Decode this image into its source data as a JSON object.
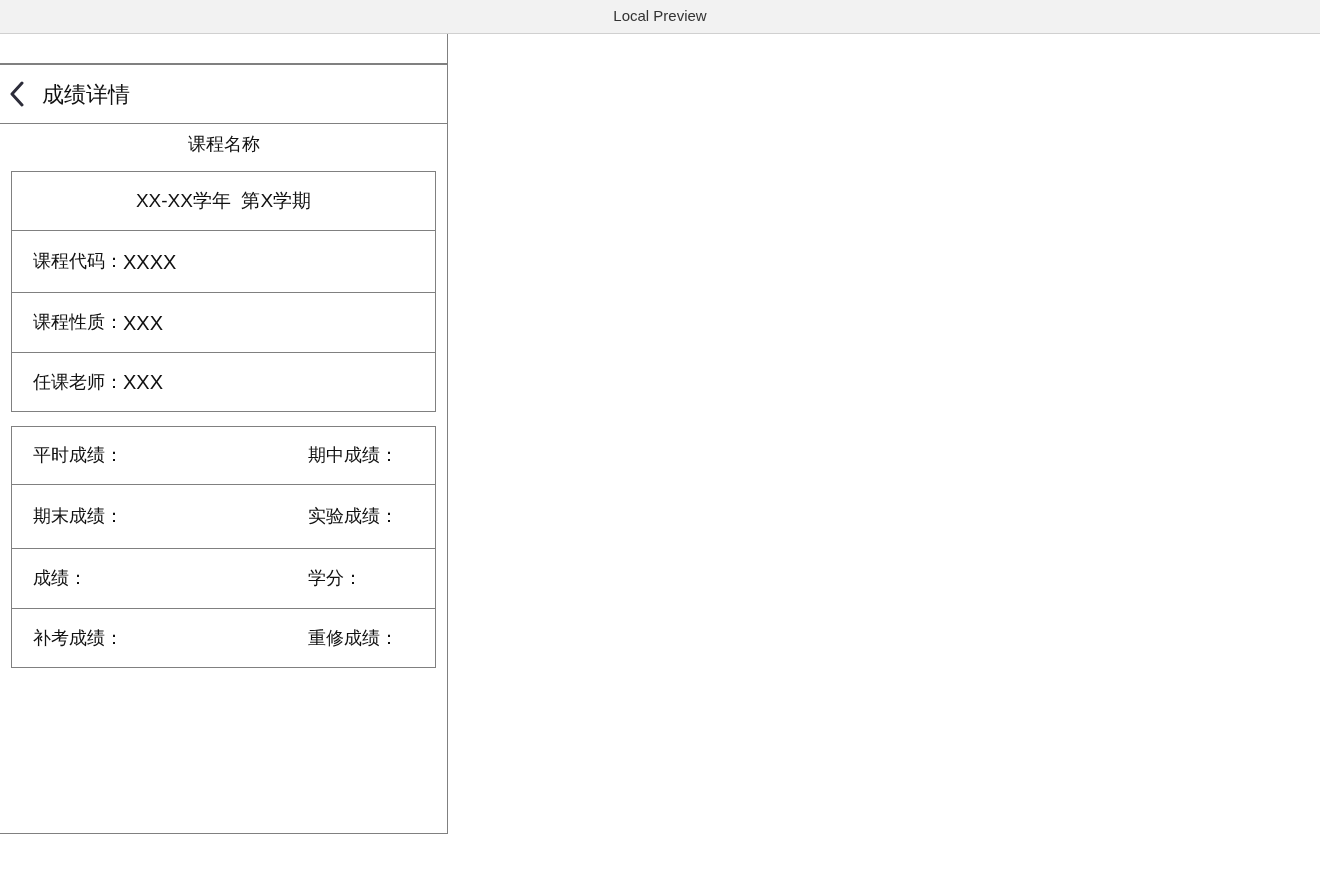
{
  "window": {
    "title": "Local Preview"
  },
  "header": {
    "title": "成绩详情"
  },
  "course_name": "课程名称",
  "info_card": {
    "term": "XX-XX学年  第X学期",
    "rows": [
      {
        "label": "课程代码：",
        "value": "XXXX"
      },
      {
        "label": "课程性质：",
        "value": "XXX"
      },
      {
        "label": "任课老师：",
        "value": "XXX"
      }
    ]
  },
  "grades_card": {
    "rows": [
      [
        "平时成绩：",
        "期中成绩："
      ],
      [
        "期末成绩：",
        "实验成绩："
      ],
      [
        "成绩：",
        "学分："
      ],
      [
        "补考成绩：",
        "重修成绩："
      ]
    ]
  }
}
